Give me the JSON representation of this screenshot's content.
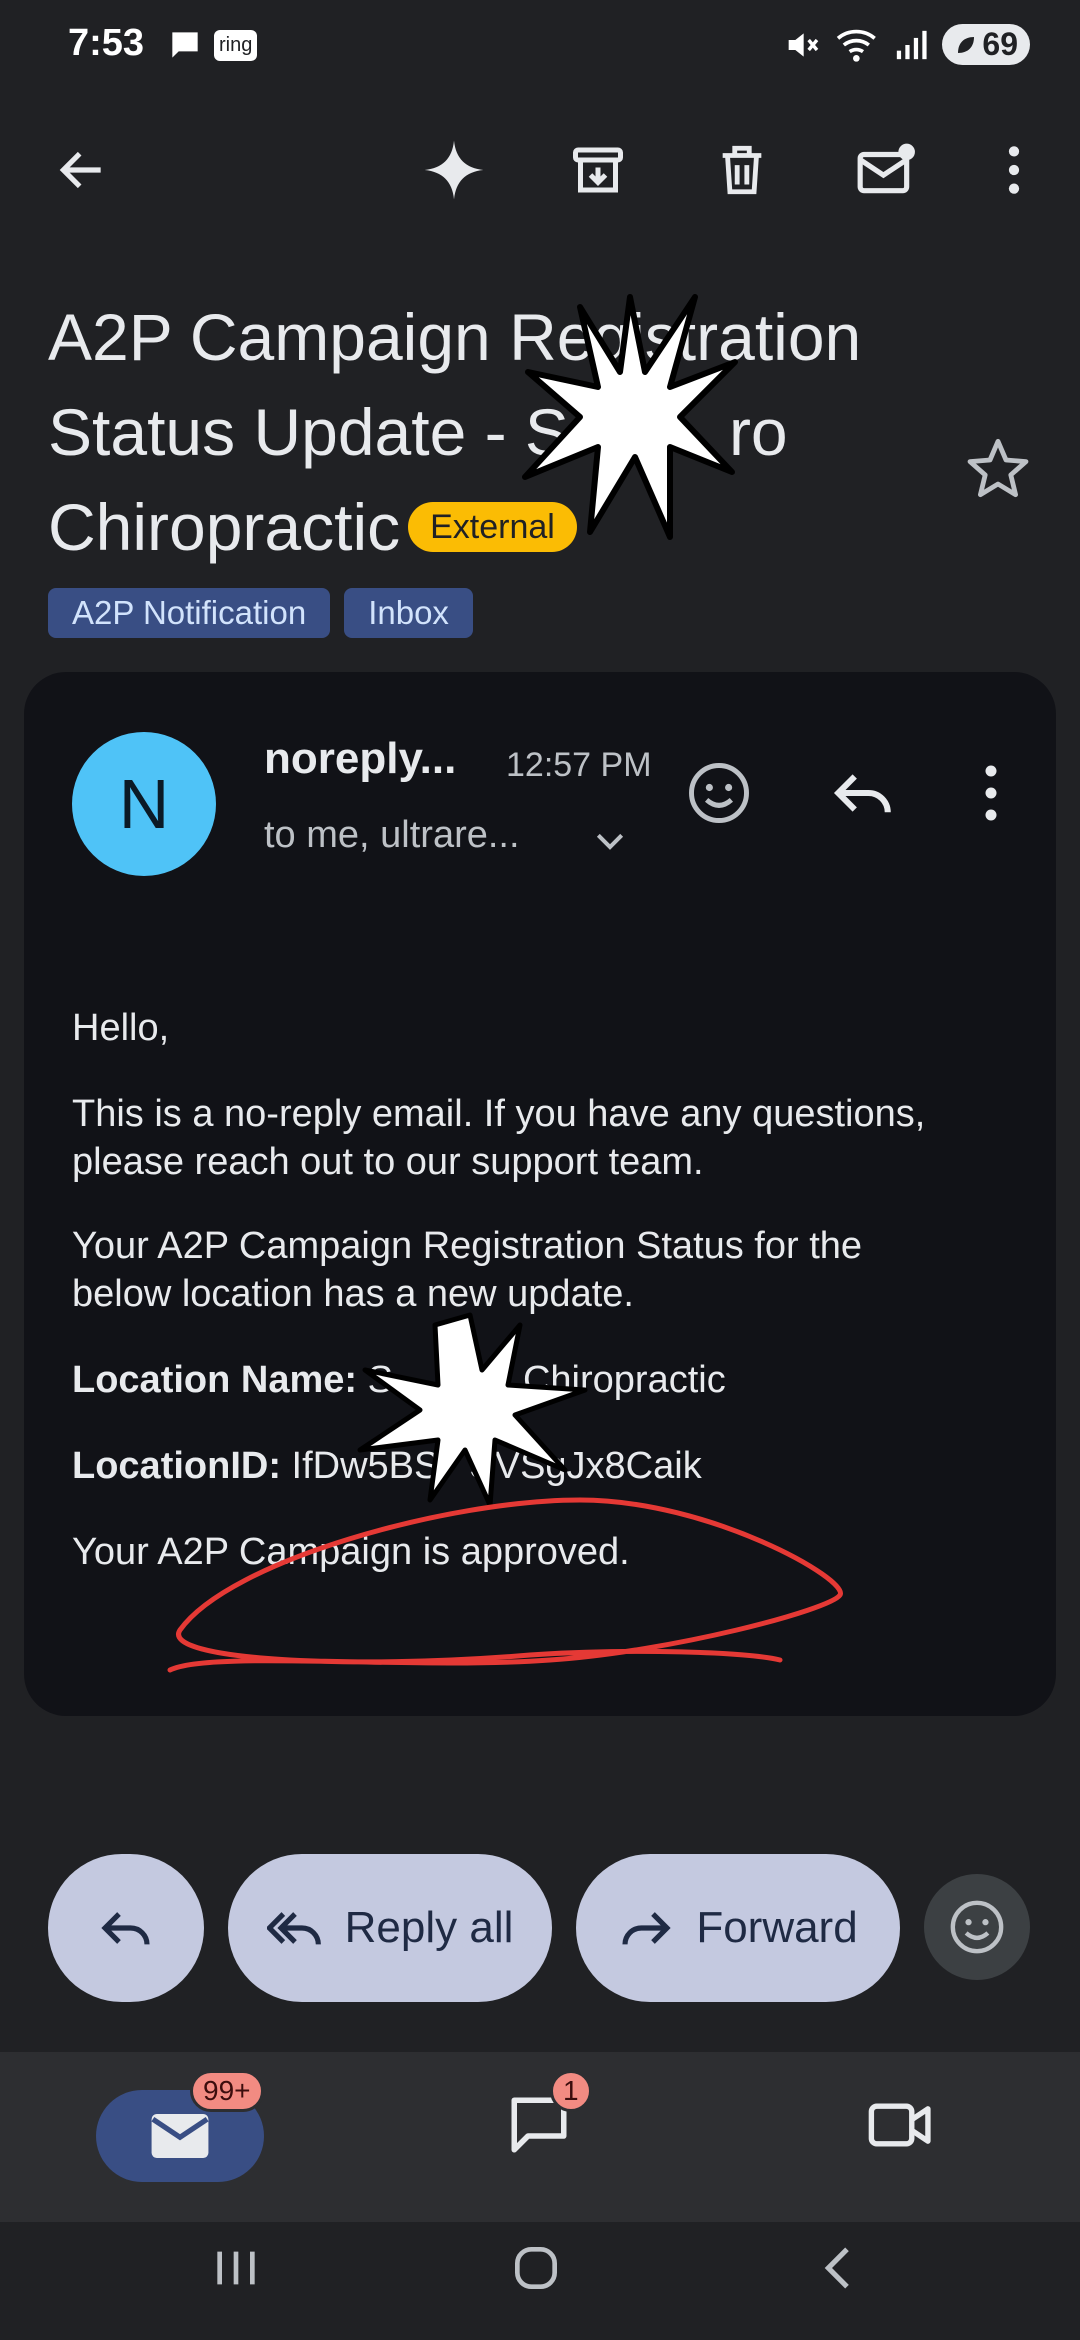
{
  "status_bar": {
    "time": "7:53",
    "notif_app": "ring",
    "network": "5",
    "battery": "69"
  },
  "toolbar": {
    "back_icon": "arrow-left-icon",
    "gemini_icon": "sparkle-icon",
    "archive_icon": "archive-icon",
    "delete_icon": "trash-icon",
    "mark_unread_icon": "mail-dot-icon",
    "more_icon": "more-vertical-icon"
  },
  "email": {
    "subject_line1": "A2P Campaign Registration",
    "subject_line2": "Status Update - S",
    "subject_line2_tail": "ro",
    "subject_line3": "Chiropractic",
    "external_badge": "External",
    "labels": [
      "A2P Notification",
      "Inbox"
    ],
    "avatar_letter": "N",
    "sender": "noreply...",
    "time": "12:57 PM",
    "recipients": "to me, ultrare...",
    "body": {
      "greeting": "Hello,",
      "p1_line1": "This is a no-reply email. If you have any questions,",
      "p1_line2": "please reach out to our support team.",
      "p2_line1": "Your A2P Campaign Registration Status for the",
      "p2_line2": "below location has a new update.",
      "location_name_label": "Location Name:",
      "location_name_value": "S",
      "location_name_tail": "Chiropractic",
      "location_id_label": "LocationID:",
      "location_id_value": "IfDw5BS",
      "location_id_tail": "SVSgJx8Caik",
      "status": "Your A2P Campaign is approved."
    }
  },
  "actions": {
    "reply_icon": "reply-icon",
    "reply_all_label": "Reply all",
    "forward_label": "Forward"
  },
  "bottom_nav": {
    "mail_badge": "99+",
    "chat_badge": "1"
  },
  "colors": {
    "background": "#202124",
    "card": "#111217",
    "accent_blue": "#394e84",
    "external_badge": "#fbbc04",
    "avatar": "#4fc3f7",
    "pill": "#c4c9e0",
    "badge": "#f28b82",
    "annotation_red": "#e53935"
  }
}
